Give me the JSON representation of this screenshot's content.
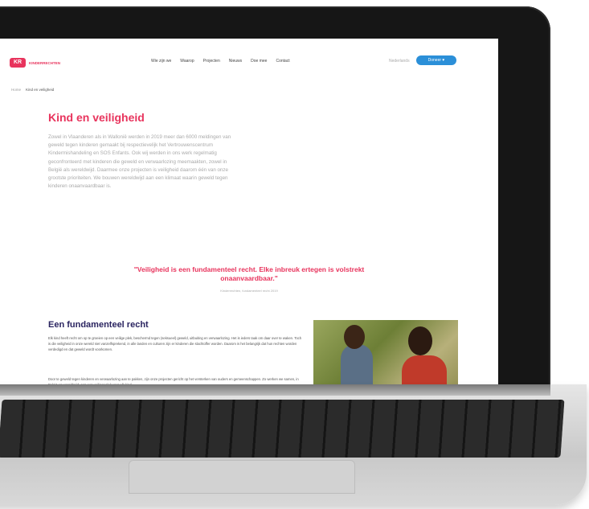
{
  "site": {
    "logo_badge": "KR",
    "logo_text": "KINDERRECHTEN",
    "nav": [
      "Wie zijn we",
      "Waarop",
      "Projecten",
      "Nieuws",
      "Doe mee",
      "Contact"
    ],
    "lang": "Nederlands",
    "donate_label": "Doneer ♥",
    "breadcrumb": [
      "Home",
      "Kind en veiligheid"
    ]
  },
  "page": {
    "title": "Kind en veiligheid",
    "intro": "Zowel in Vlaanderen als in Wallonië werden in 2019 meer dan 6000 meldingen van geweld tegen kinderen gemaakt bij respectievelijk het Vertrouwenscentrum Kindermishandeling en SOS Enfants. Ook wij werden in ons werk regelmatig geconfronteerd met kinderen die geweld en verwaarlozing meemaakten, zowel in België als wereldwijd. Daarmee onze projecten is veiligheid daarom één van onze grootste prioriteiten. We bouwen wereldwijd aan een klimaat waarin geweld tegen kinderen onaanvaardbaar is.",
    "quote": "\"Veiligheid is een fundamenteel recht. Elke inbreuk ertegen is volstrekt onaanvaardbaar.\"",
    "quote_source": "Kinderrechten, fundamenteel recht 2019",
    "section_title": "Een fundamenteel recht",
    "section_p1": "Elk kind heeft recht om op te groeien op een veilige plek, beschermd tegen (seksueel) geweld, uitbuiting en verwaarlozing. Het is ieders taak om daar over te waken. Toch is die veiligheid in onze wereld niet vanzelfsprekend, in alle landen en culturen zijn er kinderen die slachtoffer worden. Daarom is het belangrijk dat hun rechten worden verdedigd en dat geweld wordt voorkomen.",
    "section_p2": "Door te geweld tegen kinderen en verwaarlozing aan te pakken, zijn onze projecten gericht op het versterken van ouders en gemeenschappen. Zo werken we samen, in België en wereldwijd, aan een veiliger plek voor elk kind."
  },
  "icons": {
    "logo": "kr-logo-icon",
    "heart": "heart-icon"
  },
  "colors": {
    "brand": "#e8345d",
    "heading": "#2a2460",
    "button": "#2b8fd8"
  }
}
